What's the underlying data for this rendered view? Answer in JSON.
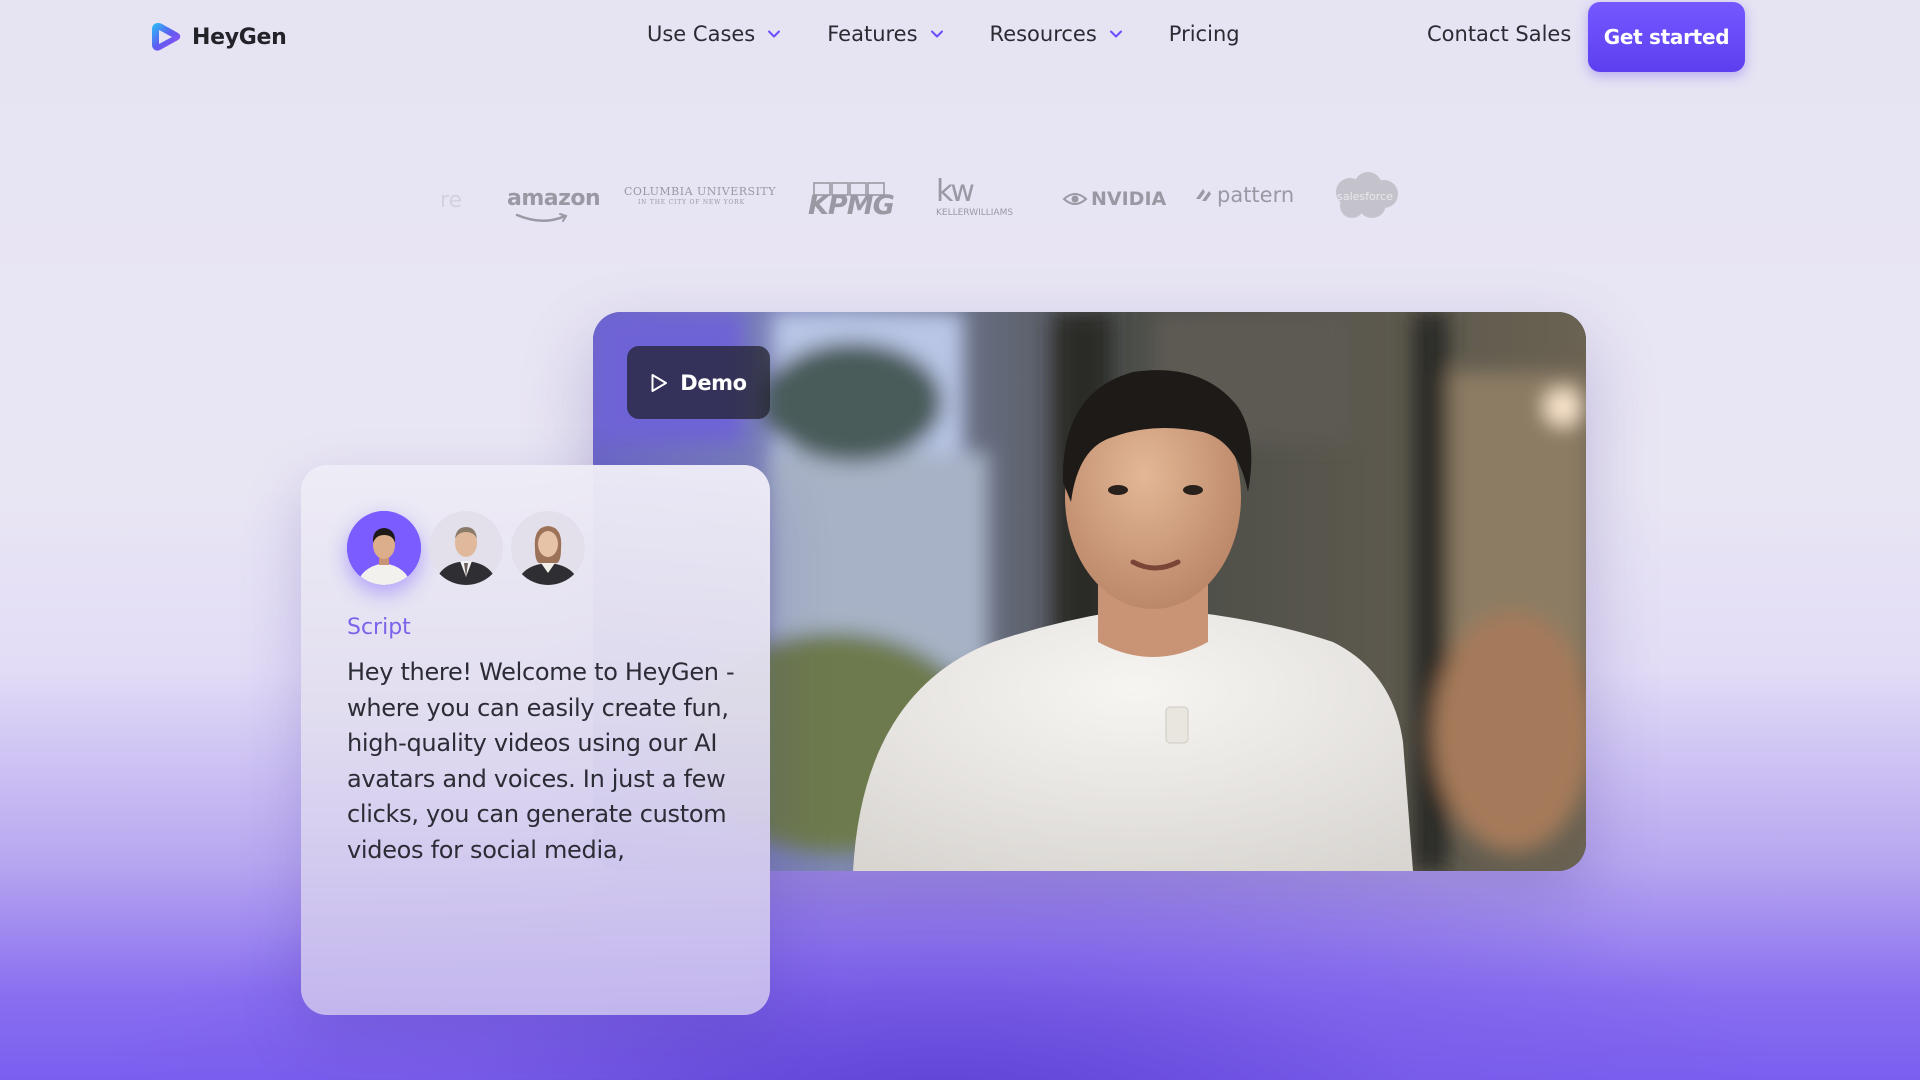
{
  "header": {
    "brand": "HeyGen",
    "nav": [
      {
        "label": "Use Cases",
        "has_dropdown": true
      },
      {
        "label": "Features",
        "has_dropdown": true
      },
      {
        "label": "Resources",
        "has_dropdown": true
      },
      {
        "label": "Pricing",
        "has_dropdown": false
      }
    ],
    "contact_label": "Contact Sales",
    "cta_label": "Get started"
  },
  "customer_logos": {
    "faded_partial": "re",
    "amazon": "amazon",
    "columbia_main": "COLUMBIA UNIVERSITY",
    "columbia_sub": "IN THE CITY OF NEW YORK",
    "kpmg": "KPMG",
    "kw": "kw",
    "kw_sub": "KELLERWILLIAMS",
    "nvidia": "NVIDIA",
    "pattern": "pattern",
    "salesforce": "salesforce"
  },
  "demo": {
    "button_label": "Demo"
  },
  "script_panel": {
    "label": "Script",
    "text": "Hey there! Welcome to HeyGen - where you can easily create fun, high-quality videos using our AI avatars and voices. In just a few clicks, you can generate custom videos for social media,"
  },
  "colors": {
    "accent": "#6a4cff",
    "script_label": "#7b63ea",
    "text": "#2b2b33"
  },
  "icons": [
    "heygen-logo-icon",
    "chevron-down-icon",
    "play-icon"
  ]
}
